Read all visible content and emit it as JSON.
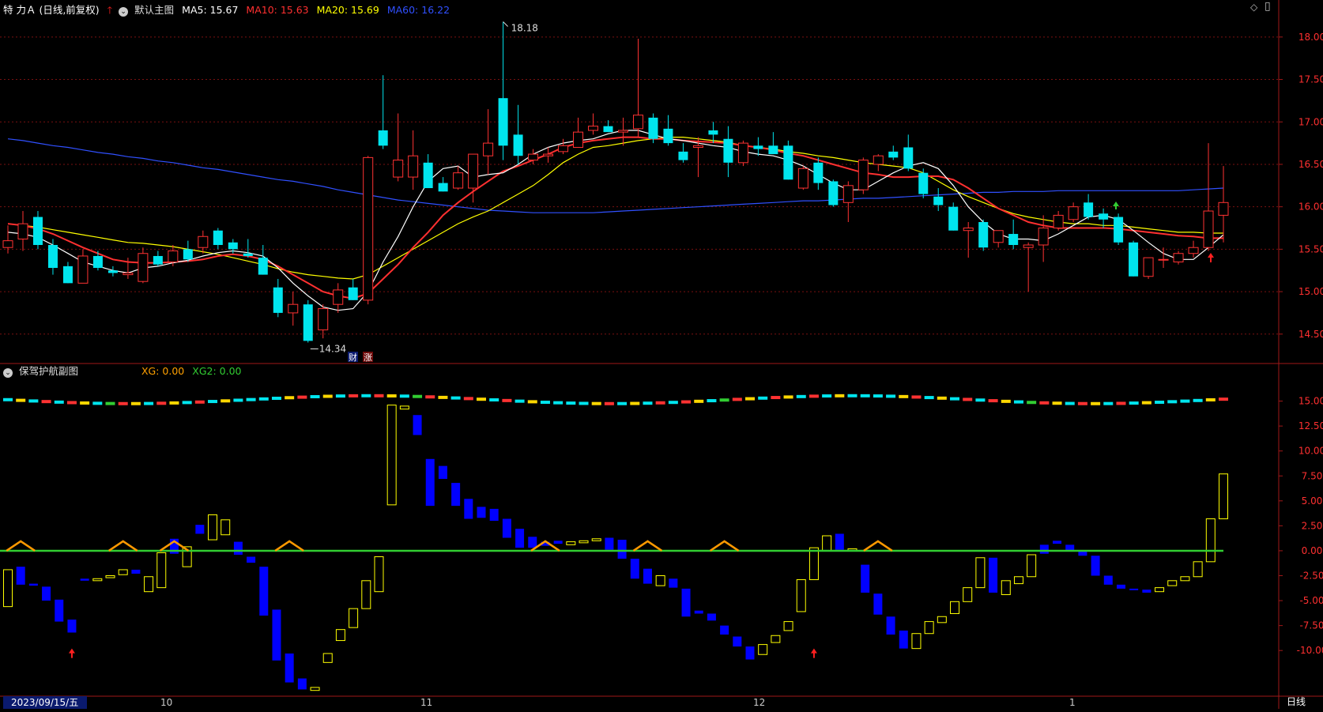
{
  "header": {
    "stock_name": "特 力Ａ (日线,前复权)",
    "main_chart_label": "默认主图",
    "ma5": "MA5: 15.67",
    "ma10": "MA10: 15.63",
    "ma20": "MA20: 15.69",
    "ma60": "MA60: 16.22",
    "ma5_color": "#ffffff",
    "ma10_color": "#ff3030",
    "ma20_color": "#ffff00",
    "ma60_color": "#3050ff"
  },
  "sub_header": {
    "indicator_label": "保驾护航副图",
    "xg": "XG: 0.00",
    "xg2": "XG2: 0.00"
  },
  "markers": {
    "high_label": "18.18",
    "low_label": "14.34",
    "cai_label": "财",
    "zhang_label": "涨"
  },
  "footer": {
    "date": "2023/09/15/五",
    "period_label": "日线",
    "months": [
      "10",
      "11",
      "12",
      "1"
    ]
  },
  "colors": {
    "up": "#ff3232",
    "down": "#00e5ee",
    "blue_bar": "#0000ff",
    "yellow_bar": "#ffff00",
    "zero_line": "#32cd32",
    "grid": "#7a1010",
    "axis_text": "#ff3030",
    "triangle": "#ff9900"
  },
  "chart_data": [
    {
      "type": "candlestick",
      "ylim": [
        14.2,
        18.25
      ],
      "yticks": [
        "18.00",
        "17.50",
        "17.00",
        "16.50",
        "16.00",
        "15.50",
        "15.00",
        "14.50"
      ],
      "ohlc": [
        [
          15.52,
          15.78,
          15.45,
          15.6
        ],
        [
          15.62,
          15.95,
          15.48,
          15.8
        ],
        [
          15.88,
          15.95,
          15.5,
          15.55
        ],
        [
          15.55,
          15.62,
          15.2,
          15.28
        ],
        [
          15.3,
          15.35,
          15.1,
          15.1
        ],
        [
          15.1,
          15.5,
          15.1,
          15.42
        ],
        [
          15.42,
          15.48,
          15.25,
          15.28
        ],
        [
          15.25,
          15.3,
          15.18,
          15.22
        ],
        [
          15.2,
          15.4,
          15.15,
          15.22
        ],
        [
          15.12,
          15.52,
          15.1,
          15.45
        ],
        [
          15.42,
          15.48,
          15.3,
          15.32
        ],
        [
          15.35,
          15.55,
          15.3,
          15.48
        ],
        [
          15.5,
          15.6,
          15.35,
          15.38
        ],
        [
          15.52,
          15.72,
          15.45,
          15.65
        ],
        [
          15.72,
          15.75,
          15.5,
          15.55
        ],
        [
          15.58,
          15.62,
          15.45,
          15.5
        ],
        [
          15.45,
          15.62,
          15.4,
          15.42
        ],
        [
          15.4,
          15.55,
          15.2,
          15.2
        ],
        [
          15.05,
          15.15,
          14.7,
          14.75
        ],
        [
          14.75,
          15.0,
          14.6,
          14.85
        ],
        [
          14.85,
          14.9,
          14.4,
          14.42
        ],
        [
          14.55,
          14.85,
          14.45,
          14.8
        ],
        [
          14.85,
          15.1,
          14.75,
          15.02
        ],
        [
          15.05,
          15.15,
          14.9,
          14.9
        ],
        [
          14.9,
          16.6,
          14.85,
          16.58
        ],
        [
          16.9,
          17.55,
          16.68,
          16.72
        ],
        [
          16.35,
          17.1,
          16.3,
          16.55
        ],
        [
          16.35,
          16.9,
          16.2,
          16.6
        ],
        [
          16.52,
          16.62,
          16.22,
          16.22
        ],
        [
          16.28,
          16.35,
          16.18,
          16.18
        ],
        [
          16.22,
          16.48,
          16.2,
          16.4
        ],
        [
          16.22,
          16.5,
          16.05,
          16.62
        ],
        [
          16.6,
          17.15,
          16.38,
          16.75
        ],
        [
          17.28,
          18.18,
          16.55,
          16.72
        ],
        [
          16.85,
          17.2,
          16.5,
          16.6
        ],
        [
          16.55,
          16.68,
          16.5,
          16.62
        ],
        [
          16.6,
          16.7,
          16.52,
          16.62
        ],
        [
          16.65,
          16.8,
          16.62,
          16.72
        ],
        [
          16.7,
          17.05,
          16.7,
          16.88
        ],
        [
          16.9,
          17.1,
          16.85,
          16.95
        ],
        [
          16.95,
          17.02,
          16.88,
          16.88
        ],
        [
          16.88,
          17.05,
          16.72,
          16.9
        ],
        [
          16.92,
          17.98,
          16.82,
          17.08
        ],
        [
          17.05,
          17.1,
          16.75,
          16.8
        ],
        [
          16.92,
          17.08,
          16.72,
          16.75
        ],
        [
          16.65,
          16.75,
          16.52,
          16.55
        ],
        [
          16.7,
          16.82,
          16.35,
          16.72
        ],
        [
          16.9,
          17.0,
          16.75,
          16.85
        ],
        [
          16.8,
          16.95,
          16.35,
          16.52
        ],
        [
          16.52,
          16.78,
          16.48,
          16.75
        ],
        [
          16.72,
          16.82,
          16.6,
          16.68
        ],
        [
          16.72,
          16.88,
          16.65,
          16.62
        ],
        [
          16.72,
          16.78,
          16.32,
          16.32
        ],
        [
          16.22,
          16.48,
          16.2,
          16.45
        ],
        [
          16.52,
          16.58,
          16.2,
          16.28
        ],
        [
          16.3,
          16.32,
          16.0,
          16.02
        ],
        [
          16.05,
          16.3,
          15.82,
          16.25
        ],
        [
          16.2,
          16.58,
          16.15,
          16.55
        ],
        [
          16.5,
          16.62,
          16.42,
          16.6
        ],
        [
          16.65,
          16.72,
          16.55,
          16.58
        ],
        [
          16.7,
          16.85,
          16.42,
          16.45
        ],
        [
          16.4,
          16.45,
          16.1,
          16.15
        ],
        [
          16.12,
          16.22,
          15.95,
          16.02
        ],
        [
          16.0,
          16.05,
          15.72,
          15.72
        ],
        [
          15.72,
          15.82,
          15.4,
          15.75
        ],
        [
          15.82,
          15.85,
          15.48,
          15.52
        ],
        [
          15.58,
          15.72,
          15.52,
          15.72
        ],
        [
          15.68,
          15.85,
          15.5,
          15.55
        ],
        [
          15.52,
          15.58,
          15.0,
          15.55
        ],
        [
          15.55,
          15.9,
          15.35,
          15.75
        ],
        [
          15.75,
          15.95,
          15.72,
          15.9
        ],
        [
          15.85,
          16.05,
          15.82,
          16.0
        ],
        [
          16.05,
          16.15,
          15.85,
          15.88
        ],
        [
          15.92,
          15.98,
          15.75,
          15.85
        ],
        [
          15.88,
          15.92,
          15.55,
          15.58
        ],
        [
          15.58,
          15.6,
          15.18,
          15.18
        ],
        [
          15.18,
          15.4,
          15.15,
          15.4
        ],
        [
          15.38,
          15.52,
          15.28,
          15.38
        ],
        [
          15.35,
          15.48,
          15.32,
          15.45
        ],
        [
          15.45,
          15.6,
          15.4,
          15.52
        ],
        [
          15.52,
          16.75,
          15.48,
          15.95
        ],
        [
          15.9,
          16.48,
          15.58,
          16.05
        ]
      ],
      "ma5": [
        15.7,
        15.68,
        15.64,
        15.55,
        15.45,
        15.35,
        15.3,
        15.25,
        15.22,
        15.28,
        15.3,
        15.34,
        15.37,
        15.42,
        15.46,
        15.48,
        15.46,
        15.42,
        15.28,
        15.1,
        14.95,
        14.82,
        14.78,
        14.8,
        15.0,
        15.35,
        15.65,
        16.0,
        16.3,
        16.45,
        16.48,
        16.35,
        16.38,
        16.4,
        16.5,
        16.62,
        16.7,
        16.75,
        16.78,
        16.8,
        16.86,
        16.9,
        16.9,
        16.85,
        16.8,
        16.78,
        16.75,
        16.72,
        16.7,
        16.65,
        16.62,
        16.6,
        16.55,
        16.48,
        16.38,
        16.28,
        16.2,
        16.2,
        16.3,
        16.4,
        16.48,
        16.52,
        16.45,
        16.25,
        16.0,
        15.82,
        15.68,
        15.62,
        15.62,
        15.6,
        15.68,
        15.78,
        15.88,
        15.9,
        15.85,
        15.72,
        15.58,
        15.45,
        15.38,
        15.38,
        15.52,
        15.67
      ],
      "ma10": [
        15.8,
        15.78,
        15.74,
        15.68,
        15.6,
        15.52,
        15.45,
        15.38,
        15.35,
        15.34,
        15.34,
        15.35,
        15.36,
        15.38,
        15.42,
        15.44,
        15.42,
        15.38,
        15.3,
        15.2,
        15.1,
        15.0,
        14.95,
        14.92,
        14.98,
        15.15,
        15.32,
        15.52,
        15.7,
        15.9,
        16.05,
        16.18,
        16.3,
        16.42,
        16.48,
        16.55,
        16.62,
        16.7,
        16.75,
        16.78,
        16.8,
        16.82,
        16.82,
        16.8,
        16.8,
        16.78,
        16.77,
        16.76,
        16.75,
        16.72,
        16.7,
        16.67,
        16.63,
        16.6,
        16.55,
        16.5,
        16.45,
        16.4,
        16.38,
        16.35,
        16.35,
        16.36,
        16.36,
        16.32,
        16.22,
        16.1,
        15.98,
        15.9,
        15.82,
        15.78,
        15.75,
        15.75,
        15.75,
        15.75,
        15.74,
        15.72,
        15.7,
        15.68,
        15.66,
        15.65,
        15.63,
        15.63
      ],
      "ma20": [
        15.8,
        15.78,
        15.76,
        15.73,
        15.7,
        15.67,
        15.64,
        15.61,
        15.58,
        15.57,
        15.55,
        15.53,
        15.5,
        15.47,
        15.44,
        15.4,
        15.36,
        15.32,
        15.27,
        15.23,
        15.2,
        15.18,
        15.16,
        15.15,
        15.2,
        15.3,
        15.4,
        15.5,
        15.6,
        15.7,
        15.8,
        15.88,
        15.95,
        16.05,
        16.15,
        16.25,
        16.38,
        16.52,
        16.62,
        16.7,
        16.72,
        16.75,
        16.78,
        16.8,
        16.82,
        16.82,
        16.8,
        16.78,
        16.76,
        16.72,
        16.7,
        16.68,
        16.65,
        16.63,
        16.6,
        16.58,
        16.55,
        16.52,
        16.5,
        16.48,
        16.46,
        16.4,
        16.3,
        16.2,
        16.12,
        16.05,
        15.98,
        15.92,
        15.88,
        15.85,
        15.82,
        15.8,
        15.8,
        15.78,
        15.78,
        15.76,
        15.74,
        15.72,
        15.7,
        15.7,
        15.69,
        15.69
      ],
      "ma60": [
        16.8,
        16.78,
        16.75,
        16.72,
        16.7,
        16.67,
        16.64,
        16.62,
        16.59,
        16.57,
        16.54,
        16.52,
        16.49,
        16.46,
        16.44,
        16.41,
        16.38,
        16.35,
        16.32,
        16.3,
        16.27,
        16.24,
        16.2,
        16.17,
        16.14,
        16.11,
        16.08,
        16.06,
        16.04,
        16.02,
        16.0,
        15.98,
        15.96,
        15.95,
        15.94,
        15.93,
        15.93,
        15.93,
        15.93,
        15.93,
        15.94,
        15.95,
        15.96,
        15.97,
        15.98,
        15.99,
        16.0,
        16.01,
        16.02,
        16.03,
        16.04,
        16.05,
        16.06,
        16.07,
        16.07,
        16.08,
        16.09,
        16.1,
        16.1,
        16.11,
        16.12,
        16.13,
        16.14,
        16.15,
        16.16,
        16.17,
        16.17,
        16.18,
        16.18,
        16.18,
        16.19,
        16.19,
        16.19,
        16.19,
        16.19,
        16.19,
        16.19,
        16.19,
        16.19,
        16.2,
        16.21,
        16.22
      ]
    },
    {
      "type": "bar",
      "ylim": [
        -14.5,
        17.5
      ],
      "yticks": [
        "15.00",
        "12.50",
        "10.00",
        "7.50",
        "5.00",
        "2.50",
        "0.00",
        "-2.50",
        "-5.00",
        "-7.50",
        "-10.00"
      ],
      "ranges": [
        [
          -5.6,
          -1.9
        ],
        [
          -1.6,
          -3.4
        ],
        [
          -3.3,
          -3.5
        ],
        [
          -3.6,
          -5.0
        ],
        [
          -4.9,
          -7.1
        ],
        [
          -6.9,
          -8.2
        ],
        [
          -2.8,
          -3.0
        ],
        [
          -3.0,
          -2.8
        ],
        [
          -2.7,
          -2.5
        ],
        [
          -2.4,
          -1.9
        ],
        [
          -1.9,
          -2.3
        ],
        [
          -4.1,
          -2.6
        ],
        [
          -3.7,
          -0.2
        ],
        [
          1.2,
          -0.3
        ],
        [
          -1.6,
          0.4
        ],
        [
          2.6,
          1.7
        ],
        [
          1.1,
          3.6
        ],
        [
          1.6,
          3.1
        ],
        [
          0.9,
          -0.4
        ],
        [
          -0.6,
          -1.2
        ],
        [
          -1.6,
          -6.5
        ],
        [
          -5.9,
          -11.0
        ],
        [
          -10.3,
          -13.2
        ],
        [
          -12.8,
          -13.9
        ],
        [
          -14.0,
          -13.7
        ],
        [
          -11.2,
          -10.3
        ],
        [
          -9.0,
          -7.9
        ],
        [
          -7.7,
          -5.8
        ],
        [
          -5.8,
          -3.0
        ],
        [
          -4.1,
          -0.6
        ],
        [
          4.6,
          14.6
        ],
        [
          14.2,
          14.5
        ],
        [
          13.6,
          11.6
        ],
        [
          9.2,
          4.5
        ],
        [
          8.5,
          7.2
        ],
        [
          6.8,
          4.5
        ],
        [
          5.2,
          3.2
        ],
        [
          4.4,
          3.3
        ],
        [
          4.2,
          3.0
        ],
        [
          3.2,
          1.3
        ],
        [
          2.2,
          0.3
        ],
        [
          1.4,
          0.3
        ],
        [
          0.9,
          0.5
        ],
        [
          1.0,
          0.7
        ],
        [
          0.6,
          0.9
        ],
        [
          0.8,
          1.0
        ],
        [
          1.0,
          1.2
        ],
        [
          1.3,
          0.1
        ],
        [
          1.1,
          -0.8
        ],
        [
          -0.8,
          -2.8
        ],
        [
          -1.8,
          -3.3
        ],
        [
          -3.5,
          -2.5
        ],
        [
          -2.8,
          -3.7
        ],
        [
          -3.8,
          -6.6
        ],
        [
          -6.0,
          -6.3
        ],
        [
          -6.3,
          -7.0
        ],
        [
          -7.5,
          -8.4
        ],
        [
          -8.6,
          -9.6
        ],
        [
          -9.6,
          -10.9
        ],
        [
          -10.4,
          -9.4
        ],
        [
          -9.2,
          -8.5
        ],
        [
          -8.0,
          -7.1
        ],
        [
          -6.1,
          -2.9
        ],
        [
          -2.9,
          0.3
        ],
        [
          0.0,
          1.5
        ],
        [
          1.7,
          0.1
        ],
        [
          0.1,
          0.2
        ],
        [
          -1.4,
          -4.2
        ],
        [
          -4.3,
          -6.4
        ],
        [
          -6.6,
          -8.4
        ],
        [
          -8.0,
          -9.8
        ],
        [
          -9.8,
          -8.3
        ],
        [
          -8.3,
          -7.1
        ],
        [
          -7.2,
          -6.6
        ],
        [
          -6.3,
          -5.1
        ],
        [
          -5.1,
          -3.7
        ],
        [
          -3.7,
          -0.7
        ],
        [
          -0.7,
          -4.2
        ],
        [
          -4.4,
          -3.0
        ],
        [
          -3.3,
          -2.6
        ],
        [
          -2.6,
          -0.4
        ],
        [
          0.6,
          -0.3
        ],
        [
          1.0,
          0.7
        ],
        [
          0.6,
          0.0
        ],
        [
          0.0,
          -0.5
        ],
        [
          -0.5,
          -2.5
        ],
        [
          -2.5,
          -3.4
        ],
        [
          -3.4,
          -3.8
        ],
        [
          -3.8,
          -3.9
        ],
        [
          -3.9,
          -4.2
        ],
        [
          -4.1,
          -3.7
        ],
        [
          -3.5,
          -3.0
        ],
        [
          -3.0,
          -2.6
        ],
        [
          -2.6,
          -1.1
        ],
        [
          -1.1,
          3.2
        ],
        [
          3.2,
          7.7
        ]
      ],
      "signal_strip": [
        "#00e5ee",
        "#ffd700",
        "#00e5ee",
        "#ff3232",
        "#00e5ee",
        "#ff3232",
        "#ffd700",
        "#00e5ee",
        "#32cd32",
        "#ff3232",
        "#ffd700",
        "#00e5ee",
        "#ff3232",
        "#ffd700",
        "#00e5ee",
        "#ff3232",
        "#00e5ee",
        "#ffd700",
        "#00e5ee",
        "#00e5ee",
        "#00e5ee",
        "#00e5ee",
        "#ffd700",
        "#ff3232"
      ],
      "zero_triangles": [
        1,
        9,
        13,
        22,
        42,
        50,
        56,
        68
      ],
      "buy_arrows": [
        5,
        63
      ]
    }
  ]
}
